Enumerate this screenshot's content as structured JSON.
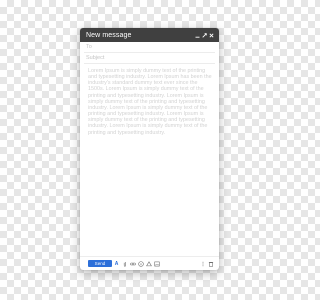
{
  "window": {
    "title": "New message"
  },
  "compose": {
    "to_placeholder": "To",
    "subject_placeholder": "Subject",
    "body": "Lorem Ipsum is simply dummy text of the printing and typesetting industry. Lorem Ipsum has been the industry's standard dummy text ever since the 1500s. Lorem Ipsum is simply dummy text of the printing and typesetting industry. Lorem Ipsum is simply dummy text of the printing and typesetting industry. Lorem Ipsum is simply dummy text of the printing and typesetting industry. Lorem Ipsum is simply dummy text of the printing and typesetting industry. Lorem Ipsum is simply dummy text of the printing and typesetting industry."
  },
  "toolbar": {
    "send_label": "Send",
    "format_label": "A",
    "icons": [
      "format-icon",
      "attach-icon",
      "link-icon",
      "emoji-icon",
      "drive-icon",
      "photo-icon",
      "more-icon",
      "trash-icon"
    ]
  },
  "colors": {
    "titlebar": "#404040",
    "accent": "#2d6fd9",
    "placeholder": "#c4c4c4",
    "body_text": "#d2d2d2"
  }
}
